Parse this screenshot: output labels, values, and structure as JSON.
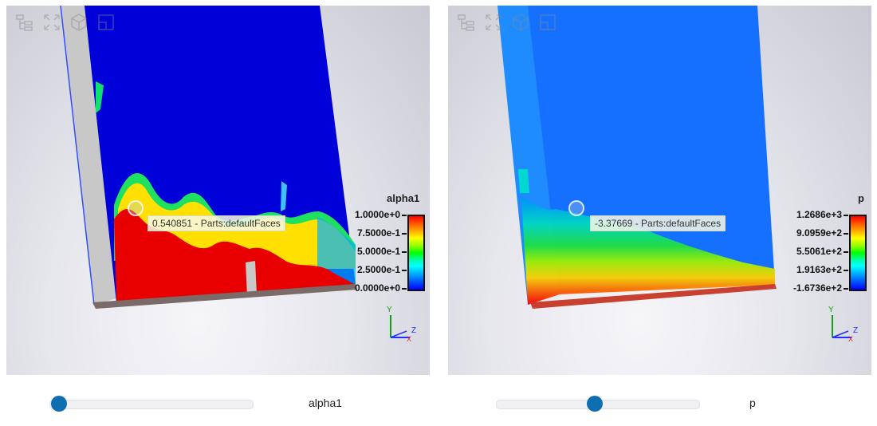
{
  "viewers": [
    {
      "field": "alpha1",
      "probe_text": "0.540851 - Parts:defaultFaces",
      "legend": {
        "title": "alpha1",
        "ticks": [
          "1.0000e+0",
          "7.5000e-1",
          "5.0000e-1",
          "2.5000e-1",
          "0.0000e+0"
        ]
      },
      "slider": {
        "label": "alpha1",
        "position_fraction": 0.02
      }
    },
    {
      "field": "p",
      "probe_text": "-3.37669 - Parts:defaultFaces",
      "legend": {
        "title": "p",
        "ticks": [
          "1.2686e+3",
          "9.0959e+2",
          "5.5061e+2",
          "1.9163e+2",
          "-1.6736e+2"
        ]
      },
      "slider": {
        "label": "p",
        "position_fraction": 0.5
      }
    }
  ],
  "toolbar_icons": [
    "tree-icon",
    "fit-view-icon",
    "cube-view-icon",
    "window-icon"
  ],
  "axes_labels": {
    "y": "Y",
    "z": "Z",
    "x": "X"
  },
  "colors": {
    "accent": "#0e6fb0",
    "field_low": "#0000ff",
    "field_high": "#ff0000"
  }
}
